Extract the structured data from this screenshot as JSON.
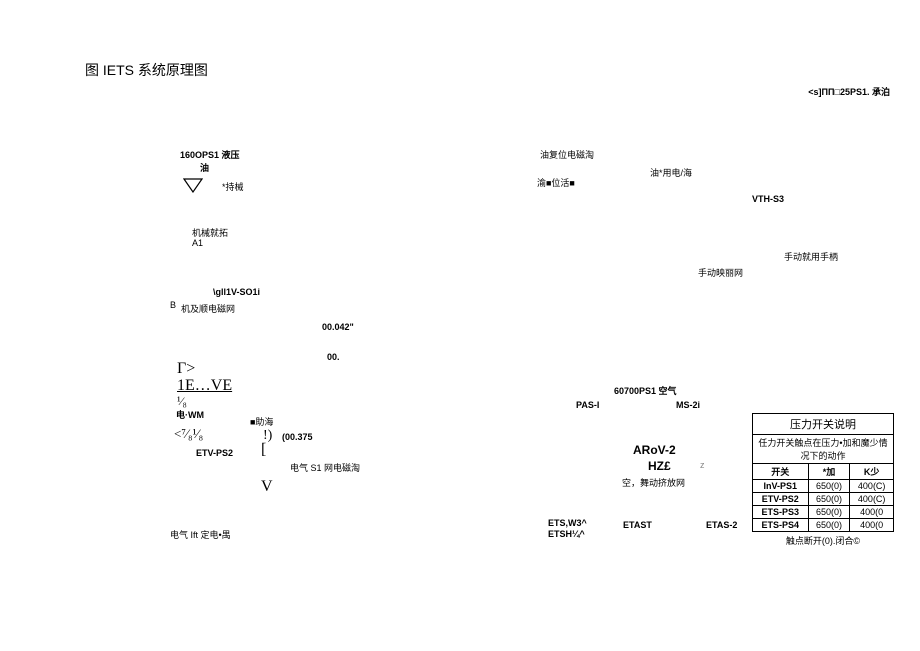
{
  "title": "图 IETS 系统原理图",
  "top_right": "<s]ΠΠ□25PS1. 承泊",
  "left": {
    "l160": "160OPS1 液压",
    "you": "油",
    "star_chi": "*持械",
    "jixie": "机械就拓",
    "a1": "A1",
    "gli": "\\gll1V-SO1i",
    "b": "B",
    "jiji": "机及顺电磁网",
    "n042": "00.042\"",
    "n00": "00.",
    "gamma": "Γ>",
    "ie_ve": "1E…VE",
    "frac18": "¹⁄₈",
    "dian_wm": "电·WM",
    "frac78_18": "<⁷⁄₈¹⁄₈",
    "bang": "!)",
    "n0375": "(00.375",
    "etv_ps2": "ETV-PS2",
    "bracket": "[",
    "dianqi_s1": "电气 S1 网电磁淘",
    "v": "V",
    "zhuhai": "■助海",
    "dianqi_ift": "电气 Ift 定电•禺"
  },
  "center": {
    "youfuwei": "油复位电磁淘",
    "yu_weihuo": "渝■位活■",
    "youyong": "油*用电/海",
    "ets_w3": "ETS,W3^",
    "etsh": "ETSH¼^"
  },
  "right": {
    "vth_s3": "VTH-S3",
    "shoudong_handle": "手动就用手柄",
    "shoudong_net": "手动映丽网",
    "ps1_60700": "60700PS1 空气",
    "pas_i": "PAS-I",
    "ms_2i": "MS-2i",
    "arov2": "ARoV-2",
    "hz": "HZ£",
    "z": "z",
    "kong_wu": "空，舞动挤放网",
    "etast": "ETAST",
    "etas_2": "ETAS-2"
  },
  "table": {
    "title": "压力开关说明",
    "subtitle": "任力开关触点在压力•加和魔少情况下的动作",
    "headers": [
      "开关",
      "*加",
      "K少"
    ],
    "rows": [
      [
        "InV-PS1",
        "650(0)",
        "400(C)"
      ],
      [
        "ETV-PS2",
        "650(0)",
        "400(C)"
      ],
      [
        "ETS-PS3",
        "650(0)",
        "400(0"
      ],
      [
        "ETS-PS4",
        "650(0)",
        "400(0"
      ]
    ],
    "footer": "触点断开(0).闭合©"
  }
}
